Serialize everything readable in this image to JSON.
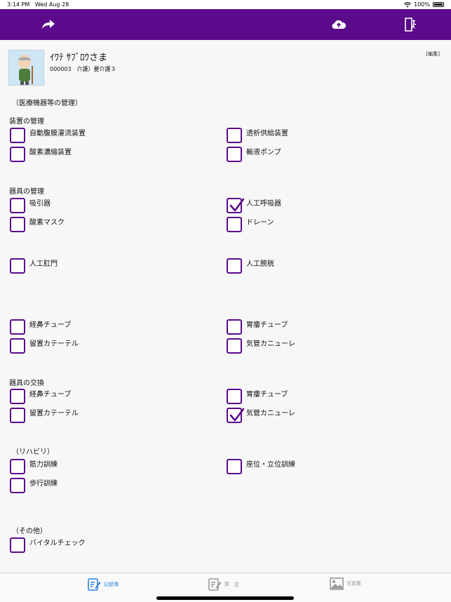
{
  "status_bar": {
    "time": "3:14 PM",
    "date": "Wed Aug 28",
    "battery": "100%"
  },
  "nav": {
    "icons": [
      "share-arrow-icon",
      "cloud-upload-icon",
      "exit-door-icon"
    ]
  },
  "profile": {
    "name": "ｲﾜﾃ ｻﾌﾞﾛｳさま",
    "sub": "000003　介護）要介護３",
    "edit": "[編集]"
  },
  "section_title": "（医療機器等の管理）",
  "groups": {
    "device_mgmt": "装置の管理",
    "instrument_mgmt": "器具の管理",
    "instrument_exchange": "器具の交換",
    "rehab": "（リハビリ）",
    "other": "（その他）"
  },
  "items": {
    "peritoneal": {
      "label": "自動腹膜灌流装置",
      "checked": false
    },
    "dialysis": {
      "label": "透析供給装置",
      "checked": false
    },
    "oxygen_concentrator": {
      "label": "酸素濃縮装置",
      "checked": false
    },
    "infusion_pump": {
      "label": "輸液ポンプ",
      "checked": false
    },
    "suction": {
      "label": "吸引器",
      "checked": false
    },
    "ventilator": {
      "label": "人工呼吸器",
      "checked": true
    },
    "oxygen_mask": {
      "label": "酸素マスク",
      "checked": false
    },
    "drain": {
      "label": "ドレーン",
      "checked": false
    },
    "stoma": {
      "label": "人工肛門",
      "checked": false
    },
    "artificial_bladder": {
      "label": "人工膀胱",
      "checked": false
    },
    "nasogastric_mgmt": {
      "label": "経鼻チューブ",
      "checked": false
    },
    "gastrostomy_mgmt": {
      "label": "胃瘻チューブ",
      "checked": false
    },
    "catheter_mgmt": {
      "label": "留置カテーテル",
      "checked": false
    },
    "tracheal_mgmt": {
      "label": "気管カニューレ",
      "checked": false
    },
    "nasogastric_ex": {
      "label": "経鼻チューブ",
      "checked": false
    },
    "gastrostomy_ex": {
      "label": "胃瘻チューブ",
      "checked": false
    },
    "catheter_ex": {
      "label": "留置カテーテル",
      "checked": false
    },
    "tracheal_ex": {
      "label": "気管カニューレ",
      "checked": true
    },
    "muscle_training": {
      "label": "筋力訓練",
      "checked": false
    },
    "sitting_standing": {
      "label": "座位・立位訓練",
      "checked": false
    },
    "walking_training": {
      "label": "歩行訓練",
      "checked": false
    },
    "vital_check": {
      "label": "バイタルチェック",
      "checked": false
    }
  },
  "tabs": {
    "records": "記録簿",
    "assessment": "算　定",
    "photos": "写真集"
  },
  "colors": {
    "brand": "#5b0a8c",
    "tab_active": "#2e86de"
  }
}
